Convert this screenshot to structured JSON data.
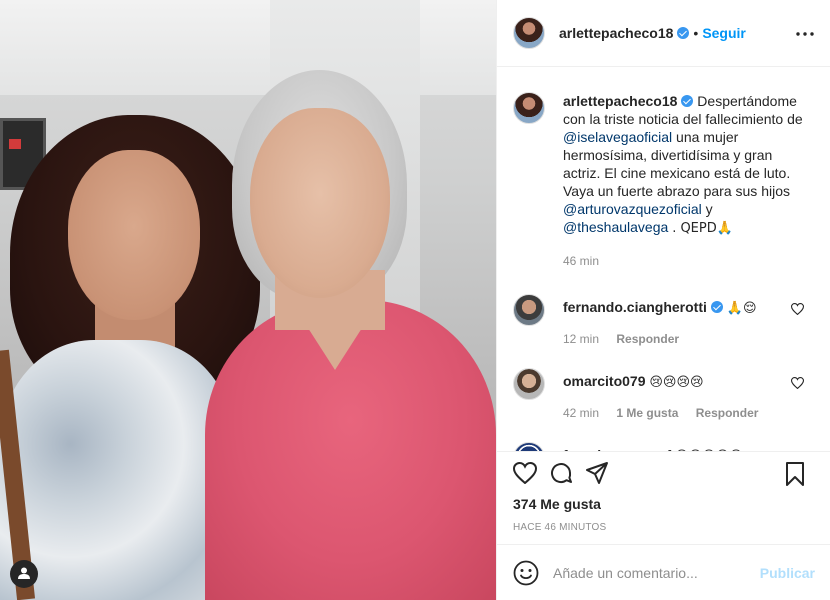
{
  "post": {
    "author": "arlettepacheco18",
    "follow_label": "Seguir",
    "caption": {
      "text_1": "Despertándome con la triste noticia del fallecimiento de",
      "mention_1": "@iselavegaoficial",
      "text_2": "una mujer hermosísima, divertidísima y gran actriz. El cine mexicano está de luto. Vaya un fuerte abrazo para sus hijos",
      "mention_2": "@arturovazquezoficial",
      "text_3": "y",
      "mention_3": "@theshaulavega",
      "text_4": ". QEPD🙏",
      "time": "46 min"
    }
  },
  "comments": [
    {
      "user": "fernando.ciangherotti",
      "verified": true,
      "text": "🙏😌",
      "time": "12 min",
      "likes": "",
      "reply_label": "Responder"
    },
    {
      "user": "omarcito079",
      "verified": false,
      "text": "😢😢😢😢",
      "time": "42 min",
      "likes": "1 Me gusta",
      "reply_label": "Responder"
    },
    {
      "user": "franciscomarzuf",
      "verified": false,
      "text": "😢😢😢😩😢",
      "time": "",
      "likes": "",
      "reply_label": ""
    }
  ],
  "engagement": {
    "likes": "374 Me gusta",
    "time_ago": "HACE 46 MINUTOS"
  },
  "add_comment": {
    "placeholder": "Añade un comentario...",
    "publish_label": "Publicar"
  },
  "icons": {
    "like": "heart-icon",
    "comment": "comment-icon",
    "share": "share-icon",
    "save": "bookmark-icon",
    "more": "more-options-icon",
    "emoji": "emoji-icon",
    "profile": "user-profile-icon"
  },
  "colors": {
    "link_blue": "#0095f6",
    "mention": "#00376b",
    "muted": "#8e8e8e",
    "verified": "#3897f0",
    "publish_disabled": "#b2dffc"
  }
}
